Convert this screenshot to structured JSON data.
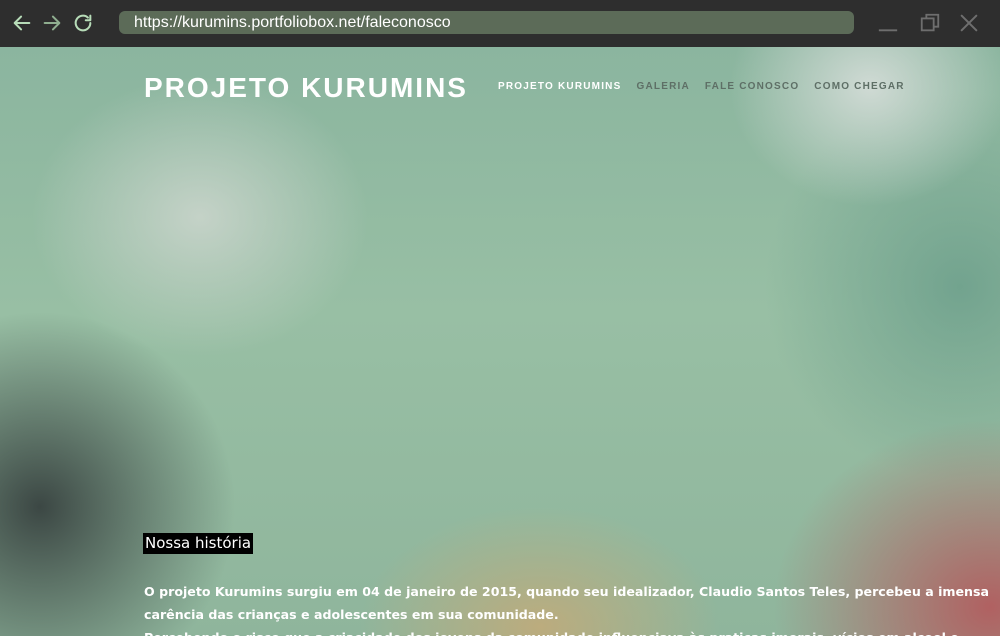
{
  "browser": {
    "url": "https://kurumins.portfoliobox.net/faleconosco"
  },
  "site": {
    "brand": "PROJETO KURUMINS",
    "nav": [
      {
        "label": "PROJETO KURUMINS"
      },
      {
        "label": "GALERIA"
      },
      {
        "label": "FALE CONOSCO"
      },
      {
        "label": "COMO CHEGAR"
      }
    ],
    "active_nav": "PROJETO KURUMINS"
  },
  "content": {
    "section_title": "Nossa história",
    "paragraph_lines": [
      "O projeto Kurumins surgiu em 04 de janeiro de 2015, quando seu idealizador, Claudio Santos Teles, percebeu a imensa",
      "carência das crianças e adolescentes em sua comunidade.",
      "Percebendo o risco que a criacidade dos jovens da comunidade influenciava às praticas imorais, vícios em alcool e"
    ]
  },
  "colors": {
    "chrome_bg": "#2e2e2e",
    "urlbar_bg": "#5c6b58",
    "nav_icon": "#b7dcb8",
    "window_icon": "#6e6e6e",
    "nav_link": "#5e6f66",
    "nav_link_active": "#ffffff"
  },
  "icons": {
    "back": "arrow-left-icon",
    "forward": "arrow-right-icon",
    "reload": "reload-icon",
    "minimize": "minimize-icon",
    "maximize": "maximize-icon",
    "close": "close-icon"
  }
}
